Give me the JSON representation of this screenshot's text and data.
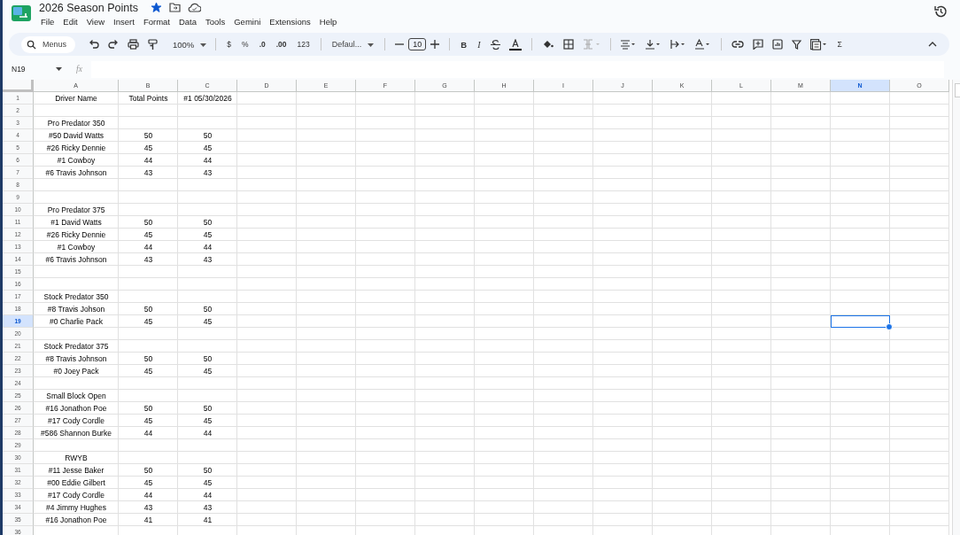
{
  "document": {
    "title": "2026 Season Points",
    "starred": true
  },
  "menu": [
    "File",
    "Edit",
    "View",
    "Insert",
    "Format",
    "Data",
    "Tools",
    "Gemini",
    "Extensions",
    "Help"
  ],
  "toolbar": {
    "search_placeholder": "Menus",
    "zoom": "100%",
    "currency": "$",
    "percent": "%",
    "decrease_decimals": ".0",
    "increase_decimals": ".00",
    "number_formats": "123",
    "font": "Defaul...",
    "font_size": "10",
    "bold": "B",
    "italic": "I",
    "sum": "Σ"
  },
  "formula_bar": {
    "name_box": "N19",
    "fx": "fx"
  },
  "columns": [
    {
      "label": "A",
      "selected": false
    },
    {
      "label": "B",
      "selected": false
    },
    {
      "label": "C",
      "selected": false
    },
    {
      "label": "D",
      "selected": false
    },
    {
      "label": "E",
      "selected": false
    },
    {
      "label": "F",
      "selected": false
    },
    {
      "label": "G",
      "selected": false
    },
    {
      "label": "H",
      "selected": false
    },
    {
      "label": "I",
      "selected": false
    },
    {
      "label": "J",
      "selected": false
    },
    {
      "label": "K",
      "selected": false
    },
    {
      "label": "L",
      "selected": false
    },
    {
      "label": "M",
      "selected": false
    },
    {
      "label": "N",
      "selected": true
    },
    {
      "label": "O",
      "selected": false
    }
  ],
  "rows": [
    {
      "number": "1",
      "selected": false,
      "cells": [
        "Driver Name",
        "Total Points",
        "#1 05/30/2026"
      ]
    },
    {
      "number": "2",
      "selected": false
    },
    {
      "number": "3",
      "selected": false,
      "cells": [
        "Pro Predator 350"
      ]
    },
    {
      "number": "4",
      "selected": false,
      "cells": [
        "#50 David Watts",
        "50",
        "50"
      ]
    },
    {
      "number": "5",
      "selected": false,
      "cells": [
        "#26 Ricky Dennie",
        "45",
        "45"
      ]
    },
    {
      "number": "6",
      "selected": false,
      "cells": [
        "#1 Cowboy",
        "44",
        "44"
      ]
    },
    {
      "number": "7",
      "selected": false,
      "cells": [
        "#6 Travis Johnson",
        "43",
        "43"
      ]
    },
    {
      "number": "8",
      "selected": false
    },
    {
      "number": "9",
      "selected": false
    },
    {
      "number": "10",
      "selected": false,
      "cells": [
        "Pro Predator 375"
      ]
    },
    {
      "number": "11",
      "selected": false,
      "cells": [
        "#1 David Watts",
        "50",
        "50"
      ]
    },
    {
      "number": "12",
      "selected": false,
      "cells": [
        "#26 Ricky Dennie",
        "45",
        "45"
      ]
    },
    {
      "number": "13",
      "selected": false,
      "cells": [
        "#1 Cowboy",
        "44",
        "44"
      ]
    },
    {
      "number": "14",
      "selected": false,
      "cells": [
        "#6 Travis Johnson",
        "43",
        "43"
      ]
    },
    {
      "number": "15",
      "selected": false
    },
    {
      "number": "16",
      "selected": false
    },
    {
      "number": "17",
      "selected": false,
      "cells": [
        "Stock Predator 350"
      ]
    },
    {
      "number": "18",
      "selected": false,
      "cells": [
        "#8 Travis Johson",
        "50",
        "50"
      ]
    },
    {
      "number": "19",
      "selected": true,
      "cells": [
        "#0 Charlie Pack",
        "45",
        "45"
      ]
    },
    {
      "number": "20",
      "selected": false
    },
    {
      "number": "21",
      "selected": false,
      "cells": [
        "Stock Predator 375"
      ]
    },
    {
      "number": "22",
      "selected": false,
      "cells": [
        "#8 Travis Johnson",
        "50",
        "50"
      ]
    },
    {
      "number": "23",
      "selected": false,
      "cells": [
        "#0 Joey Pack",
        "45",
        "45"
      ]
    },
    {
      "number": "24",
      "selected": false
    },
    {
      "number": "25",
      "selected": false,
      "cells": [
        "Small Block Open"
      ]
    },
    {
      "number": "26",
      "selected": false,
      "cells": [
        "#16 Jonathon Poe",
        "50",
        "50"
      ]
    },
    {
      "number": "27",
      "selected": false,
      "cells": [
        "#17 Cody Cordle",
        "45",
        "45"
      ]
    },
    {
      "number": "28",
      "selected": false,
      "cells": [
        "#586 Shannon Burke",
        "44",
        "44"
      ]
    },
    {
      "number": "29",
      "selected": false
    },
    {
      "number": "30",
      "selected": false,
      "cells": [
        "RWYB"
      ]
    },
    {
      "number": "31",
      "selected": false,
      "cells": [
        "#11 Jesse Baker",
        "50",
        "50"
      ]
    },
    {
      "number": "32",
      "selected": false,
      "cells": [
        "#00 Eddie Gilbert",
        "45",
        "45"
      ]
    },
    {
      "number": "33",
      "selected": false,
      "cells": [
        "#17 Cody Cordle",
        "44",
        "44"
      ]
    },
    {
      "number": "34",
      "selected": false,
      "cells": [
        "#4 Jimmy Hughes",
        "43",
        "43"
      ]
    },
    {
      "number": "35",
      "selected": false,
      "cells": [
        "#16 Jonathon Poe",
        "41",
        "41"
      ]
    },
    {
      "number": "36",
      "selected": false
    }
  ]
}
